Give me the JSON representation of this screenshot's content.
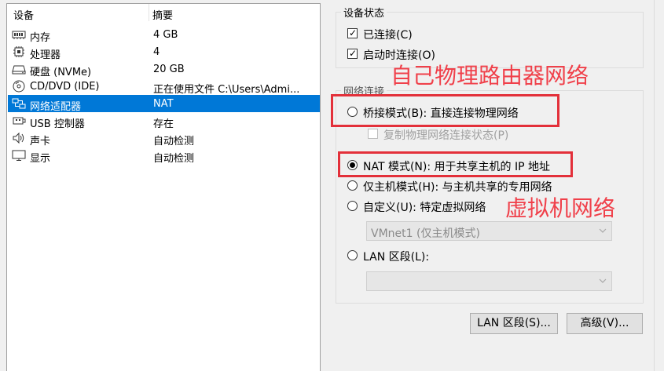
{
  "device_list": {
    "header": {
      "device": "设备",
      "summary": "摘要"
    },
    "items": [
      {
        "name": "内存",
        "summary": "4 GB",
        "icon": "memory-icon"
      },
      {
        "name": "处理器",
        "summary": "4",
        "icon": "cpu-icon"
      },
      {
        "name": "硬盘 (NVMe)",
        "summary": "20 GB",
        "icon": "harddisk-icon"
      },
      {
        "name": "CD/DVD (IDE)",
        "summary": "正在使用文件 C:\\Users\\Admi...",
        "icon": "cd-dvd-icon"
      },
      {
        "name": "网络适配器",
        "summary": "NAT",
        "icon": "network-adapter-icon",
        "selected": true
      },
      {
        "name": "USB 控制器",
        "summary": "存在",
        "icon": "usb-icon"
      },
      {
        "name": "声卡",
        "summary": "自动检测",
        "icon": "sound-icon"
      },
      {
        "name": "显示",
        "summary": "自动检测",
        "icon": "display-icon"
      }
    ]
  },
  "device_status": {
    "title": "设备状态",
    "connected": {
      "label": "已连接(C)",
      "checked": true
    },
    "connect_at_power_on": {
      "label": "启动时连接(O)",
      "checked": true
    }
  },
  "network_connection": {
    "title": "网络连接",
    "bridged": {
      "label": "桥接模式(B): 直接连接物理网络",
      "selected": false
    },
    "replicate": {
      "label": "复制物理网络连接状态(P)",
      "checked": false,
      "enabled": false
    },
    "nat": {
      "label": "NAT 模式(N): 用于共享主机的 IP 地址",
      "selected": true
    },
    "host_only": {
      "label": "仅主机模式(H): 与主机共享的专用网络",
      "selected": false
    },
    "custom": {
      "label": "自定义(U): 特定虚拟网络",
      "selected": false
    },
    "custom_select_value": "VMnet1 (仅主机模式)",
    "lan_segment": {
      "label": "LAN 区段(L):",
      "selected": false
    },
    "lan_select_value": ""
  },
  "buttons": {
    "lan_segments": "LAN 区段(S)...",
    "advanced": "高级(V)..."
  },
  "annotations": {
    "physical_router": "自己物理路由器网络",
    "virtual_network": "虚拟机网络"
  },
  "colors": {
    "selection": "#0078d7",
    "annotation": "#e3303a"
  }
}
